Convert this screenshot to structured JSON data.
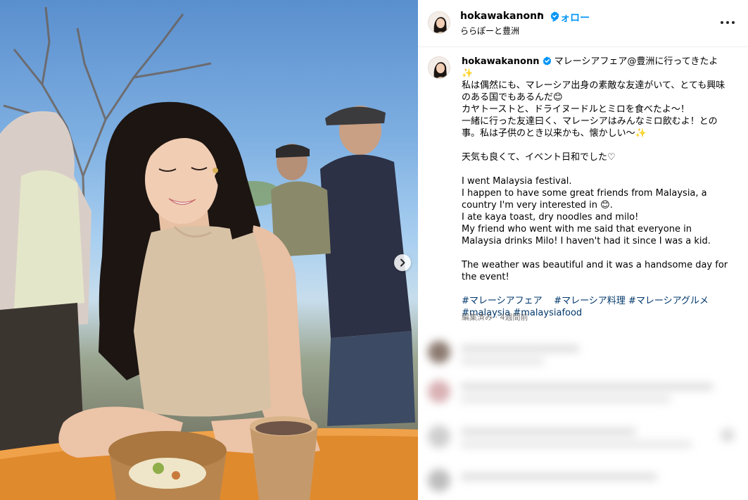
{
  "post": {
    "username": "hokawakanonn",
    "separator": "•",
    "follow_label": "フォロー",
    "location": "ららぽーと豊洲",
    "caption_first_line": "マレーシアフェア@豊洲に行ってきたよ✨",
    "caption_jp": [
      "私は偶然にも、マレーシア出身の素敵な友達がいて、とても興味のある国でもあるんだ😊",
      "カヤトーストと、ドライヌードルとミロを食べたよ〜！",
      "一緒に行った友達曰く、マレーシアはみんなミロ飲むよ！との事。私は子供のとき以来かも、懐かしい〜✨"
    ],
    "caption_jp_2": "天気も良くて、イベント日和でした♡",
    "caption_en": [
      "I went Malaysia festival.",
      "I happen to have some great friends from Malaysia, a country I'm very interested in 😊.",
      "I ate kaya toast, dry noodles and milo!",
      "My friend who went with me said that everyone in Malaysia drinks Milo! I haven't had it since I was a kid."
    ],
    "caption_en_2": "The weather was beautiful and it was a handsome day for the event!",
    "hashtags": [
      "#マレーシアフェア",
      "#マレーシア料理",
      "#マレーシアグルメ",
      "#malaysia",
      "#malaysiafood"
    ],
    "meta": "編集済み · 4週間前"
  },
  "icons": {
    "verified": "verified-badge-icon",
    "more": "more-options-icon",
    "next": "chevron-right-icon"
  },
  "colors": {
    "link_blue": "#0095f6",
    "hashtag": "#00376b",
    "verified": "#0095f6",
    "meta_gray": "#737373"
  }
}
